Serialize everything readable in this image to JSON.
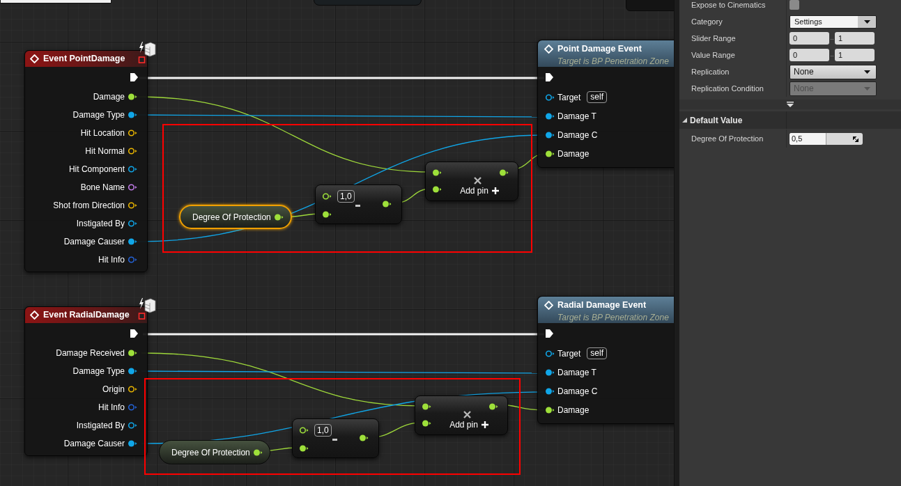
{
  "graph": {
    "nodes": [
      {
        "kind": "event",
        "title": "Event PointDamage",
        "pins": [
          {
            "label": "Damage",
            "color": "#9ee03a",
            "connected": true
          },
          {
            "label": "Damage Type",
            "color": "#10a6e8",
            "connected": true
          },
          {
            "label": "Hit Location",
            "color": "#e8b400",
            "connected": false
          },
          {
            "label": "Hit Normal",
            "color": "#e8b400",
            "connected": false
          },
          {
            "label": "Hit Component",
            "color": "#10a6e8",
            "connected": false
          },
          {
            "label": "Bone Name",
            "color": "#c07be8",
            "connected": false
          },
          {
            "label": "Shot from Direction",
            "color": "#e8b400",
            "connected": false
          },
          {
            "label": "Instigated By",
            "color": "#10a6e8",
            "connected": false
          },
          {
            "label": "Damage Causer",
            "color": "#10a6e8",
            "connected": true
          },
          {
            "label": "Hit Info",
            "color": "#2462d6",
            "connected": false
          }
        ]
      },
      {
        "kind": "call",
        "title": "Point Damage Event",
        "subtitle": "Target is BP Penetration Zone",
        "pins": [
          {
            "label": "Target",
            "color": "#10a6e8",
            "connected": false,
            "default": "self"
          },
          {
            "label": "Damage T",
            "color": "#10a6e8",
            "connected": true
          },
          {
            "label": "Damage C",
            "color": "#10a6e8",
            "connected": true
          },
          {
            "label": "Damage",
            "color": "#9ee03a",
            "connected": true
          }
        ]
      },
      {
        "kind": "variable",
        "label": "Degree Of Protection",
        "selected": true
      },
      {
        "kind": "subtract",
        "inputs": [
          {
            "connected": false,
            "value": "1,0"
          },
          {
            "connected": true
          }
        ]
      },
      {
        "kind": "multiply",
        "action": "Add pin"
      },
      {
        "kind": "event",
        "title": "Event RadialDamage",
        "pins": [
          {
            "label": "Damage Received",
            "color": "#9ee03a",
            "connected": true
          },
          {
            "label": "Damage Type",
            "color": "#10a6e8",
            "connected": true
          },
          {
            "label": "Origin",
            "color": "#e8b400",
            "connected": false
          },
          {
            "label": "Hit Info",
            "color": "#2462d6",
            "connected": false
          },
          {
            "label": "Instigated By",
            "color": "#10a6e8",
            "connected": false
          },
          {
            "label": "Damage Causer",
            "color": "#10a6e8",
            "connected": true
          }
        ]
      },
      {
        "kind": "call",
        "title": "Radial Damage Event",
        "subtitle": "Target is BP Penetration Zone",
        "pins": [
          {
            "label": "Target",
            "color": "#10a6e8",
            "connected": false,
            "default": "self"
          },
          {
            "label": "Damage T",
            "color": "#10a6e8",
            "connected": true
          },
          {
            "label": "Damage C",
            "color": "#10a6e8",
            "connected": true
          },
          {
            "label": "Damage",
            "color": "#9ee03a",
            "connected": true
          }
        ]
      },
      {
        "kind": "variable",
        "label": "Degree Of Protection",
        "selected": false
      },
      {
        "kind": "subtract",
        "inputs": [
          {
            "connected": false,
            "value": "1,0"
          },
          {
            "connected": true
          }
        ]
      },
      {
        "kind": "multiply",
        "action": "Add pin"
      }
    ]
  },
  "details": {
    "rows": [
      {
        "kind": "checkbox",
        "label": "Expose to Cinematics",
        "checked": false
      },
      {
        "kind": "combo",
        "label": "Category",
        "value": "Settings"
      },
      {
        "kind": "range",
        "label": "Slider Range",
        "min": "0",
        "separator": "..",
        "max": "1"
      },
      {
        "kind": "range",
        "label": "Value Range",
        "min": "0",
        "separator": "..",
        "max": "1"
      },
      {
        "kind": "dropdown",
        "label": "Replication",
        "value": "None",
        "disabled": false
      },
      {
        "kind": "dropdown",
        "label": "Replication Condition",
        "value": "None",
        "disabled": true
      }
    ],
    "section": {
      "title": "Default Value",
      "expanded": true,
      "rows": [
        {
          "kind": "slider",
          "label": "Degree Of Protection",
          "value": "0,5",
          "level": 0.5
        }
      ]
    }
  }
}
